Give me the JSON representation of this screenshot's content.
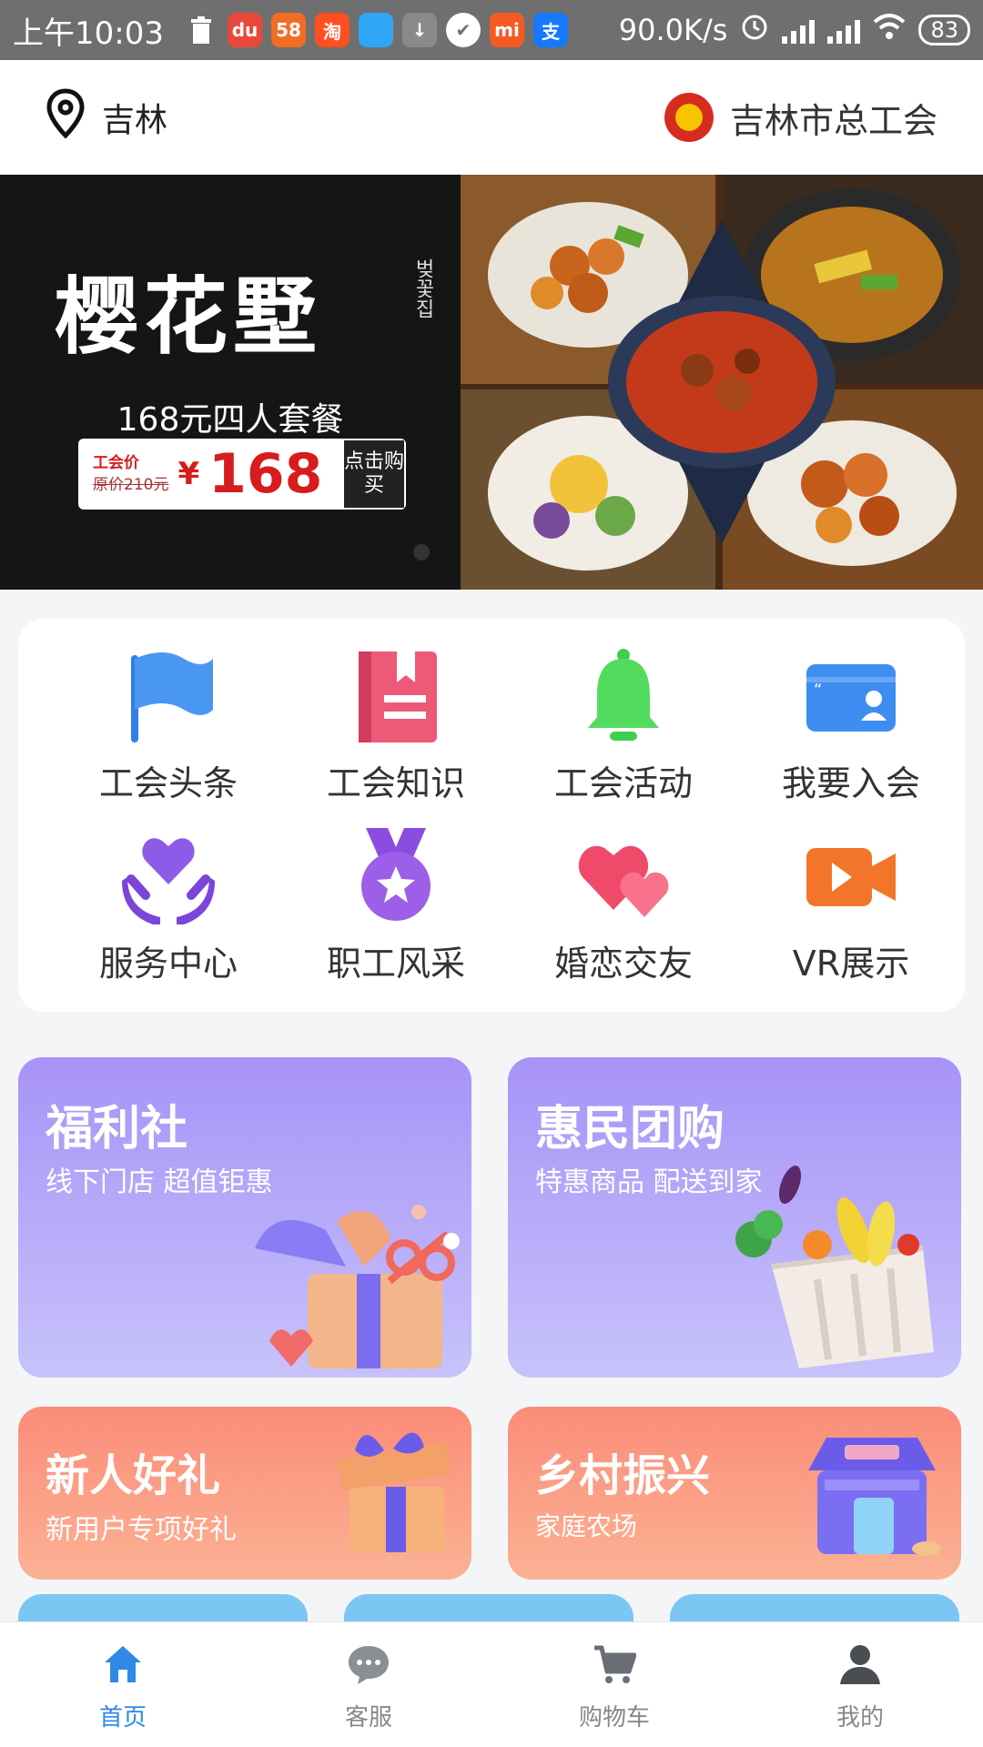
{
  "status_bar": {
    "time": "上午10:03",
    "app_icons": [
      {
        "name": "trash-icon",
        "label": "",
        "color": "#6f6f6f"
      },
      {
        "name": "du-app-icon",
        "label": "du",
        "color": "#e8483a"
      },
      {
        "name": "58-app-icon",
        "label": "58",
        "color": "#f36c25"
      },
      {
        "name": "taobao-app-icon",
        "label": "淘",
        "color": "#ff4f1f"
      },
      {
        "name": "blue-app-icon",
        "label": "",
        "color": "#2fa6f5"
      },
      {
        "name": "download-icon",
        "label": "↓",
        "color": "#8a8a8a"
      },
      {
        "name": "check-app-icon",
        "label": "✔",
        "color": "#6f6f6f"
      },
      {
        "name": "mi-app-icon",
        "label": "mi",
        "color": "#f55a22"
      },
      {
        "name": "alipay-app-icon",
        "label": "支",
        "color": "#1677ff"
      }
    ],
    "network_speed": "90.0K/s",
    "battery": "83"
  },
  "header": {
    "location": "吉林",
    "organization": "吉林市总工会"
  },
  "banner": {
    "brand": "樱花墅",
    "brand_sub": "벚꽃집",
    "set_title": "168元四人套餐",
    "union_price_label": "工会价",
    "original_price": "原价210元",
    "currency": "¥",
    "price": "168",
    "buy_label": "点击购买"
  },
  "categories": [
    {
      "label": "工会头条",
      "icon": "flag-icon",
      "color": "#3d8ef0"
    },
    {
      "label": "工会知识",
      "icon": "book-icon",
      "color": "#ea4a6a"
    },
    {
      "label": "工会活动",
      "icon": "bell-icon",
      "color": "#4fd65a"
    },
    {
      "label": "我要入会",
      "icon": "member-card-icon",
      "color": "#3d8ef0"
    },
    {
      "label": "服务中心",
      "icon": "heart-hands-icon",
      "color": "#8b55e6"
    },
    {
      "label": "职工风采",
      "icon": "medal-icon",
      "color": "#9b5de5"
    },
    {
      "label": "婚恋交友",
      "icon": "hearts-icon",
      "color": "#f04a6a"
    },
    {
      "label": "VR展示",
      "icon": "video-camera-icon",
      "color": "#f2752a"
    }
  ],
  "features": [
    {
      "title": "福利社",
      "subtitle": "线下门店 超值钜惠"
    },
    {
      "title": "惠民团购",
      "subtitle": "特惠商品 配送到家"
    },
    {
      "title": "新人好礼",
      "subtitle": "新用户专项好礼"
    },
    {
      "title": "乡村振兴",
      "subtitle": "家庭农场"
    }
  ],
  "bottom_nav": [
    {
      "label": "首页",
      "icon": "home-icon",
      "active": true
    },
    {
      "label": "客服",
      "icon": "chat-icon",
      "active": false
    },
    {
      "label": "购物车",
      "icon": "cart-icon",
      "active": false
    },
    {
      "label": "我的",
      "icon": "user-icon",
      "active": false
    }
  ],
  "colors": {
    "accent": "#2e8ae6",
    "card_purple": "#a793f7",
    "card_orange": "#fb8c78",
    "price_red": "#d61c1c"
  }
}
